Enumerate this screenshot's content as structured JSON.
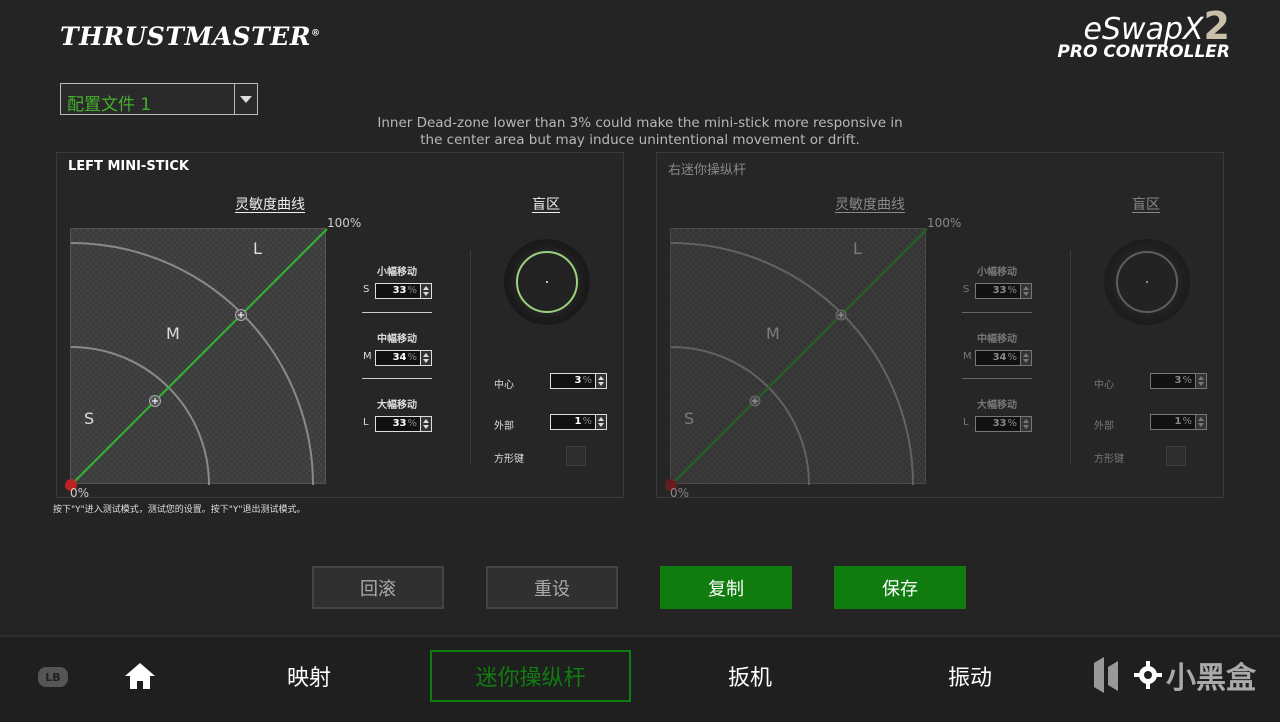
{
  "header": {
    "brand": "THRUSTMASTER",
    "brand_mark": "®",
    "product_line1": "eSwapX",
    "product_number": "2",
    "product_line2": "PRO CONTROLLER"
  },
  "profile": {
    "selected": "配置文件 1"
  },
  "info_text_line1": "Inner Dead-zone lower than 3% could make the mini-stick more responsive in",
  "info_text_line2": "the center area but may induce unintentional movement or drift.",
  "left_panel": {
    "title": "LEFT MINI-STICK",
    "curve_label": "灵敏度曲线",
    "deadzone_label": "盲区",
    "pct_top": "100%",
    "pct_bottom": "0%",
    "zone_s": "S",
    "zone_m": "M",
    "zone_l": "L",
    "small_title": "小幅移动",
    "small_value": "33",
    "mid_title": "中幅移动",
    "mid_value": "34",
    "large_title": "大幅移动",
    "large_value": "33",
    "unit": "%",
    "center_label": "中心",
    "center_value": "3",
    "outer_label": "外部",
    "outer_value": "1",
    "square_label": "方形键"
  },
  "right_panel": {
    "title": "右迷你操纵杆",
    "curve_label": "灵敏度曲线",
    "deadzone_label": "盲区",
    "pct_top": "100%",
    "pct_bottom": "0%",
    "zone_s": "S",
    "zone_m": "M",
    "zone_l": "L",
    "small_title": "小幅移动",
    "small_value": "33",
    "mid_title": "中幅移动",
    "mid_value": "34",
    "large_title": "大幅移动",
    "large_value": "33",
    "unit": "%",
    "center_label": "中心",
    "center_value": "3",
    "outer_label": "外部",
    "outer_value": "1",
    "square_label": "方形键"
  },
  "hint": "按下\"Y\"进入测试模式，测试您的设置。按下\"Y\"退出测试模式。",
  "buttons": {
    "rollback": "回滚",
    "reset": "重设",
    "copy": "复制",
    "save": "保存"
  },
  "nav": {
    "lb": "LB",
    "mapping": "映射",
    "ministick": "迷你操纵杆",
    "trigger": "扳机",
    "vibration": "振动",
    "watermark": "小黑盒"
  },
  "colors": {
    "accent": "#107c10",
    "profile_text": "#43b02a",
    "curve": "#2db82d",
    "origin": "#b22"
  }
}
